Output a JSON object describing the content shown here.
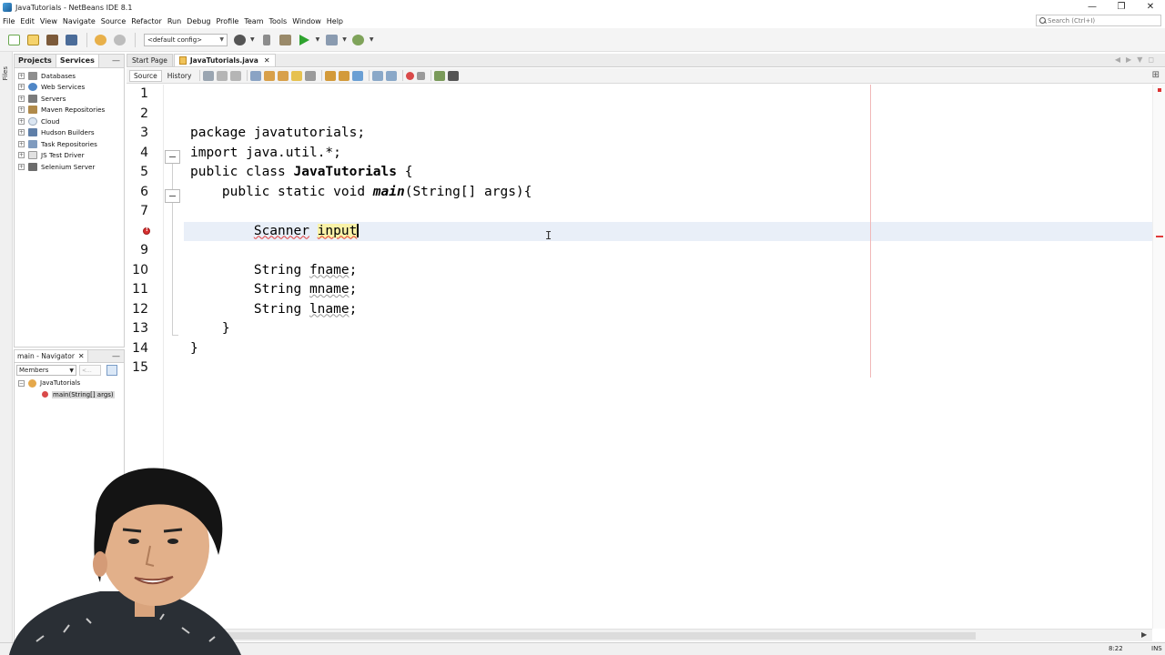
{
  "window": {
    "title": "JavaTutorials - NetBeans IDE 8.1",
    "controls": [
      "—",
      "❐",
      "✕"
    ]
  },
  "menu": [
    "File",
    "Edit",
    "View",
    "Navigate",
    "Source",
    "Refactor",
    "Run",
    "Debug",
    "Profile",
    "Team",
    "Tools",
    "Window",
    "Help"
  ],
  "search": {
    "placeholder": "Search (Ctrl+I)"
  },
  "toolbar": {
    "config": "<default config>"
  },
  "left_strip": {
    "label": "Files"
  },
  "projects_panel": {
    "tabs": [
      "Projects",
      "Services"
    ],
    "active_tab": "Services",
    "minimize": "—",
    "items": [
      "Databases",
      "Web Services",
      "Servers",
      "Maven Repositories",
      "Cloud",
      "Hudson Builders",
      "Task Repositories",
      "JS Test Driver",
      "Selenium Server"
    ]
  },
  "navigator": {
    "title": "main - Navigator",
    "close": "✕",
    "minimize": "—",
    "filter": "Members",
    "filter2": "<...",
    "tree_root": "JavaTutorials",
    "tree_child": "main(String[] args)"
  },
  "editor": {
    "tabs": [
      "Start Page",
      "JavaTutorials.java"
    ],
    "active_tab": "JavaTutorials.java",
    "tab_close": "✕",
    "mode_source": "Source",
    "mode_history": "History"
  },
  "code": {
    "line_numbers": [
      "1",
      "2",
      "3",
      "4",
      "5",
      "6",
      "7",
      "",
      "9",
      "10",
      "11",
      "12",
      "13",
      "14",
      "15"
    ],
    "lines": {
      "l3a": "package",
      "l3b": " javatutorials;",
      "l4a": "import",
      "l4b": " java.util.*;",
      "l5a": "public class ",
      "l5b": "JavaTutorials",
      "l5c": " {",
      "l6a": "    public static void ",
      "l6b": "main",
      "l6c": "(String[] args){",
      "l8a": "        ",
      "l8b": "Scanner",
      "l8c": " ",
      "l8d": "input",
      "l10a": "        String ",
      "l10b": "fname",
      "l10c": ";",
      "l11a": "        String ",
      "l11b": "mname",
      "l11c": ";",
      "l12a": "        String ",
      "l12b": "lname",
      "l12c": ";",
      "l13": "    }",
      "l14": "}"
    }
  },
  "status": {
    "position": "8:22",
    "mode": "INS"
  },
  "colors": {
    "error": "#d72f2f",
    "highlight": "#f9f2a8",
    "current_line": "#e9eff8",
    "margin": "#f1b8b8"
  }
}
